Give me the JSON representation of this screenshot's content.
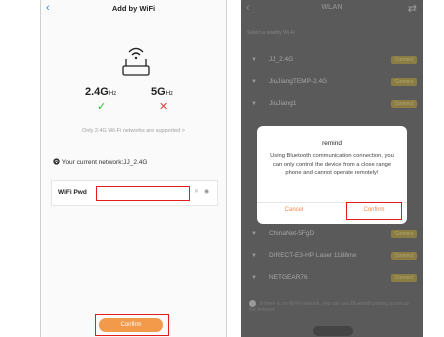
{
  "left_screen": {
    "back_label": "‹",
    "title": "Add by WiFi",
    "band_24_value": "2.4G",
    "band_24_unit": "Hz",
    "band_5_value": "5G",
    "band_5_unit": "Hz",
    "supported_mark": "✓",
    "unsupported_mark": "✕",
    "note": "Only 2.4G Wi-Fi networks are supported >",
    "current_network_label": "Your current network:JJ_2.4G",
    "password_label": "WiFi Pwd",
    "password_value": "",
    "confirm_label": "Confirm",
    "accent_color": "#f2994a"
  },
  "right_screen": {
    "back_label": "‹",
    "title": "WLAN",
    "refresh_icon": "⇄",
    "section_label": "Select a nearby Wi-Fi",
    "networks": [
      {
        "name": "JJ_2.4G",
        "action": "Connect"
      },
      {
        "name": "JiuJiangTEMP-2.4G",
        "action": "Connect"
      },
      {
        "name": "JiuJiang1",
        "action": "Connect"
      },
      {
        "name": "ChinaNet-5FgD",
        "action": "Connect"
      },
      {
        "name": "DIRECT-E3-HP Laser 1188nw",
        "action": "Connect"
      },
      {
        "name": "NETGEAR76",
        "action": "Connect"
      }
    ],
    "tip": "If there is no Wi-Fi network, you can use Bluetooth pairing to set up the network",
    "dialog": {
      "title": "remind",
      "body": "Using Bluetooth communication connection, you can only control the device from a close range phone and cannot operate remotely!",
      "cancel_label": "Cancel",
      "confirm_label": "Confirm"
    }
  }
}
